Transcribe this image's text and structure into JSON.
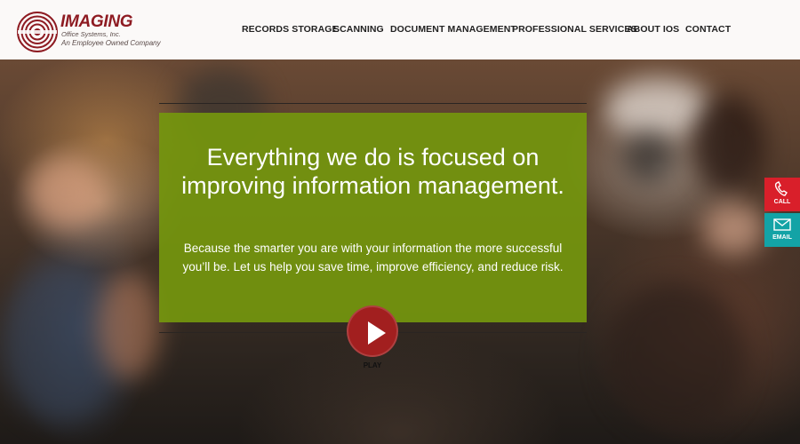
{
  "brand": {
    "name": "IMAGING",
    "subname": "Office Systems, Inc.",
    "tagline": "An Employee Owned Company",
    "color": "#8e1b22"
  },
  "nav": {
    "items": [
      {
        "label": "RECORDS STORAGE"
      },
      {
        "label": "SCANNING"
      },
      {
        "label": "DOCUMENT MANAGEMENT"
      },
      {
        "label": "PROFESSIONAL SERVICES"
      },
      {
        "label": "ABOUT IOS"
      },
      {
        "label": "CONTACT"
      }
    ]
  },
  "hero": {
    "title": "Everything we do is focused on improving information management.",
    "body": "Because the smarter you are with your information the more successful you’ll be. Let us help you save time, improve efficiency, and reduce risk.",
    "panel_color": "#74960e",
    "play_label": "PLAY",
    "play_color": "#a21f1f"
  },
  "side": {
    "call_label": "CALL",
    "call_icon": "phone-icon",
    "call_color": "#d91f2a",
    "email_label": "EMAIL",
    "email_icon": "envelope-icon",
    "email_color": "#13a3a6"
  }
}
